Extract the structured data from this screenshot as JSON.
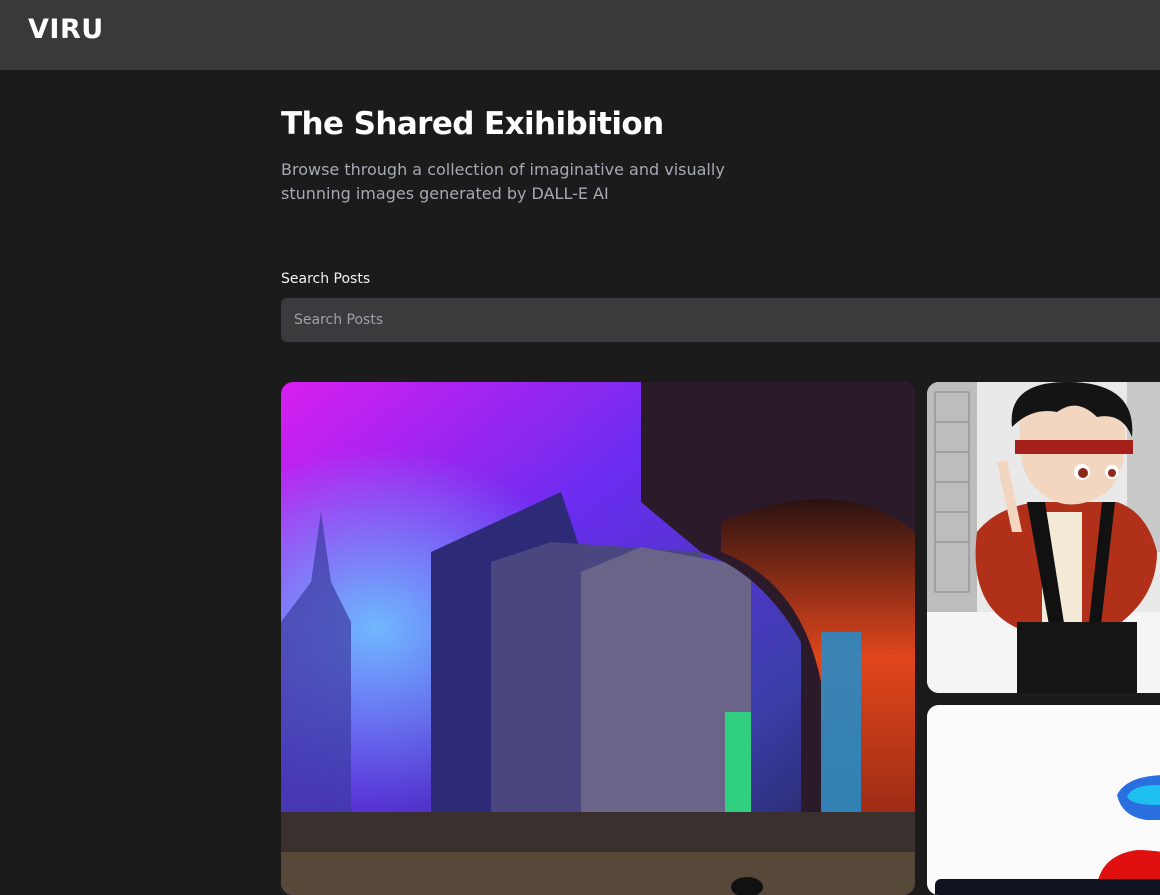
{
  "app": {
    "logo": "VIRU"
  },
  "hero": {
    "title": "The Shared Exihibition",
    "subtitle": "Browse through a collection of imaginative and visually stunning images generated by DALL-E AI"
  },
  "search": {
    "label": "Search Posts",
    "placeholder": "Search Posts",
    "value": ""
  },
  "gallery": {
    "cards": [
      {
        "kind": "image",
        "subject": "neon-lit ruined city street"
      },
      {
        "kind": "image",
        "subject": "anime boy with red headband and scarf"
      },
      {
        "kind": "image",
        "subject": "colorful toy on white background"
      }
    ]
  },
  "colors": {
    "page_background": "#1b1b1b",
    "topbar_background": "#393939",
    "input_background": "#3b3b3d",
    "subtitle_text": "#a6a9b3"
  }
}
